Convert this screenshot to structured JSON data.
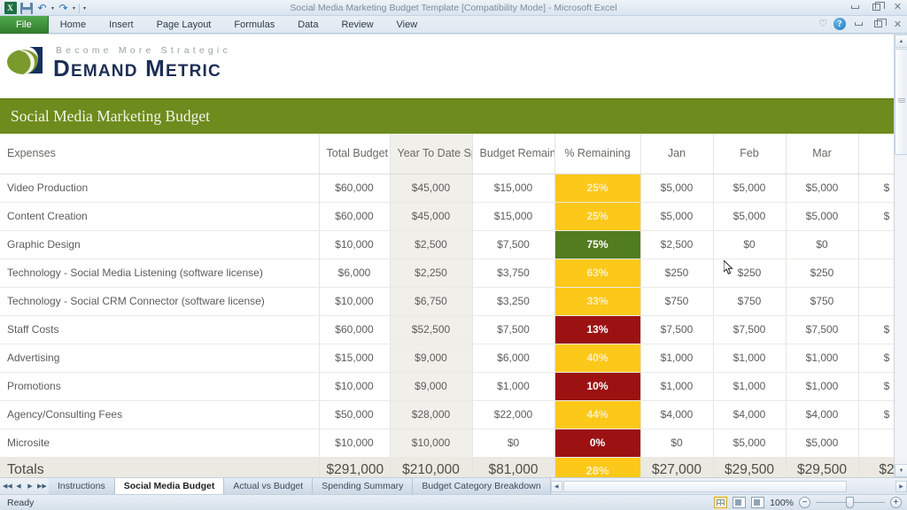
{
  "window": {
    "title": "Social Media Marketing Budget Template  [Compatibility Mode]  -  Microsoft Excel",
    "quick_access": [
      {
        "name": "excel-logo",
        "glyph": "X"
      },
      {
        "name": "save-icon",
        "glyph": ""
      },
      {
        "name": "undo-icon",
        "glyph": "↶"
      },
      {
        "name": "redo-icon",
        "glyph": "↷"
      },
      {
        "name": "customize-qat-icon",
        "glyph": "▾"
      }
    ],
    "controls": {
      "minimize": "–",
      "restore": "❐",
      "close": "✕"
    }
  },
  "ribbon": {
    "tabs": [
      {
        "label": "File",
        "active": false,
        "file": true
      },
      {
        "label": "Home",
        "active": false
      },
      {
        "label": "Insert",
        "active": false
      },
      {
        "label": "Page Layout",
        "active": false
      },
      {
        "label": "Formulas",
        "active": false
      },
      {
        "label": "Data",
        "active": false
      },
      {
        "label": "Review",
        "active": false
      },
      {
        "label": "View",
        "active": false
      }
    ],
    "help_glyph": "?",
    "heart_glyph": "♡"
  },
  "logo": {
    "tagline": "Become More Strategic",
    "name_part1": "D",
    "name_part1b": "EMAND",
    "name_part2": "M",
    "name_part2b": "ETRIC",
    "green": "#7b9a2e",
    "navy": "#1c2e54"
  },
  "banner": {
    "title": "Social Media Marketing Budget",
    "bg": "#6e8b1e"
  },
  "colors": {
    "yellow": "#fcc81a",
    "green": "#517c1f",
    "red": "#9c1212",
    "shade": "#f0efe9"
  },
  "table": {
    "headers": [
      "Expenses",
      "Total Budget",
      "Year To Date Spend",
      "Budget Remaining",
      "% Remaining",
      "Jan",
      "Feb",
      "Mar",
      ""
    ],
    "rows": [
      {
        "expense": "Video Production",
        "total": "$60,000",
        "ytd": "$45,000",
        "remaining": "$15,000",
        "pct": "25%",
        "pct_color": "yellow",
        "jan": "$5,000",
        "feb": "$5,000",
        "mar": "$5,000",
        "apr": "$"
      },
      {
        "expense": "Content Creation",
        "total": "$60,000",
        "ytd": "$45,000",
        "remaining": "$15,000",
        "pct": "25%",
        "pct_color": "yellow",
        "jan": "$5,000",
        "feb": "$5,000",
        "mar": "$5,000",
        "apr": "$"
      },
      {
        "expense": "Graphic Design",
        "total": "$10,000",
        "ytd": "$2,500",
        "remaining": "$7,500",
        "pct": "75%",
        "pct_color": "green",
        "jan": "$2,500",
        "feb": "$0",
        "mar": "$0",
        "apr": ""
      },
      {
        "expense": "Technology - Social Media Listening (software license)",
        "total": "$6,000",
        "ytd": "$2,250",
        "remaining": "$3,750",
        "pct": "63%",
        "pct_color": "yellow",
        "jan": "$250",
        "feb": "$250",
        "mar": "$250",
        "apr": ""
      },
      {
        "expense": "Technology - Social CRM Connector (software license)",
        "total": "$10,000",
        "ytd": "$6,750",
        "remaining": "$3,250",
        "pct": "33%",
        "pct_color": "yellow",
        "jan": "$750",
        "feb": "$750",
        "mar": "$750",
        "apr": ""
      },
      {
        "expense": "Staff Costs",
        "total": "$60,000",
        "ytd": "$52,500",
        "remaining": "$7,500",
        "pct": "13%",
        "pct_color": "red",
        "jan": "$7,500",
        "feb": "$7,500",
        "mar": "$7,500",
        "apr": "$"
      },
      {
        "expense": "Advertising",
        "total": "$15,000",
        "ytd": "$9,000",
        "remaining": "$6,000",
        "pct": "40%",
        "pct_color": "yellow",
        "jan": "$1,000",
        "feb": "$1,000",
        "mar": "$1,000",
        "apr": "$"
      },
      {
        "expense": "Promotions",
        "total": "$10,000",
        "ytd": "$9,000",
        "remaining": "$1,000",
        "pct": "10%",
        "pct_color": "red",
        "jan": "$1,000",
        "feb": "$1,000",
        "mar": "$1,000",
        "apr": "$"
      },
      {
        "expense": "Agency/Consulting Fees",
        "total": "$50,000",
        "ytd": "$28,000",
        "remaining": "$22,000",
        "pct": "44%",
        "pct_color": "yellow",
        "jan": "$4,000",
        "feb": "$4,000",
        "mar": "$4,000",
        "apr": "$"
      },
      {
        "expense": "Microsite",
        "total": "$10,000",
        "ytd": "$10,000",
        "remaining": "$0",
        "pct": "0%",
        "pct_color": "red",
        "jan": "$0",
        "feb": "$5,000",
        "mar": "$5,000",
        "apr": ""
      }
    ],
    "totals": {
      "expense": "Totals",
      "total": "$291,000",
      "ytd": "$210,000",
      "remaining": "$81,000",
      "pct": "28%",
      "pct_color": "yellow",
      "jan": "$27,000",
      "feb": "$29,500",
      "mar": "$29,500",
      "apr": "$2"
    }
  },
  "sheet_tabs": {
    "nav": [
      "◀◀",
      "◀",
      "▶",
      "▶▶"
    ],
    "items": [
      {
        "label": "Instructions",
        "active": false
      },
      {
        "label": "Social Media Budget",
        "active": true
      },
      {
        "label": "Actual vs Budget",
        "active": false
      },
      {
        "label": "Spending Summary",
        "active": false
      },
      {
        "label": "Budget Category Breakdown",
        "active": false
      }
    ]
  },
  "status": {
    "mode": "Ready",
    "zoom": "100%",
    "view_buttons": [
      "normal-view",
      "page-layout-view",
      "page-break-view"
    ],
    "zoom_out": "−",
    "zoom_in": "+"
  }
}
